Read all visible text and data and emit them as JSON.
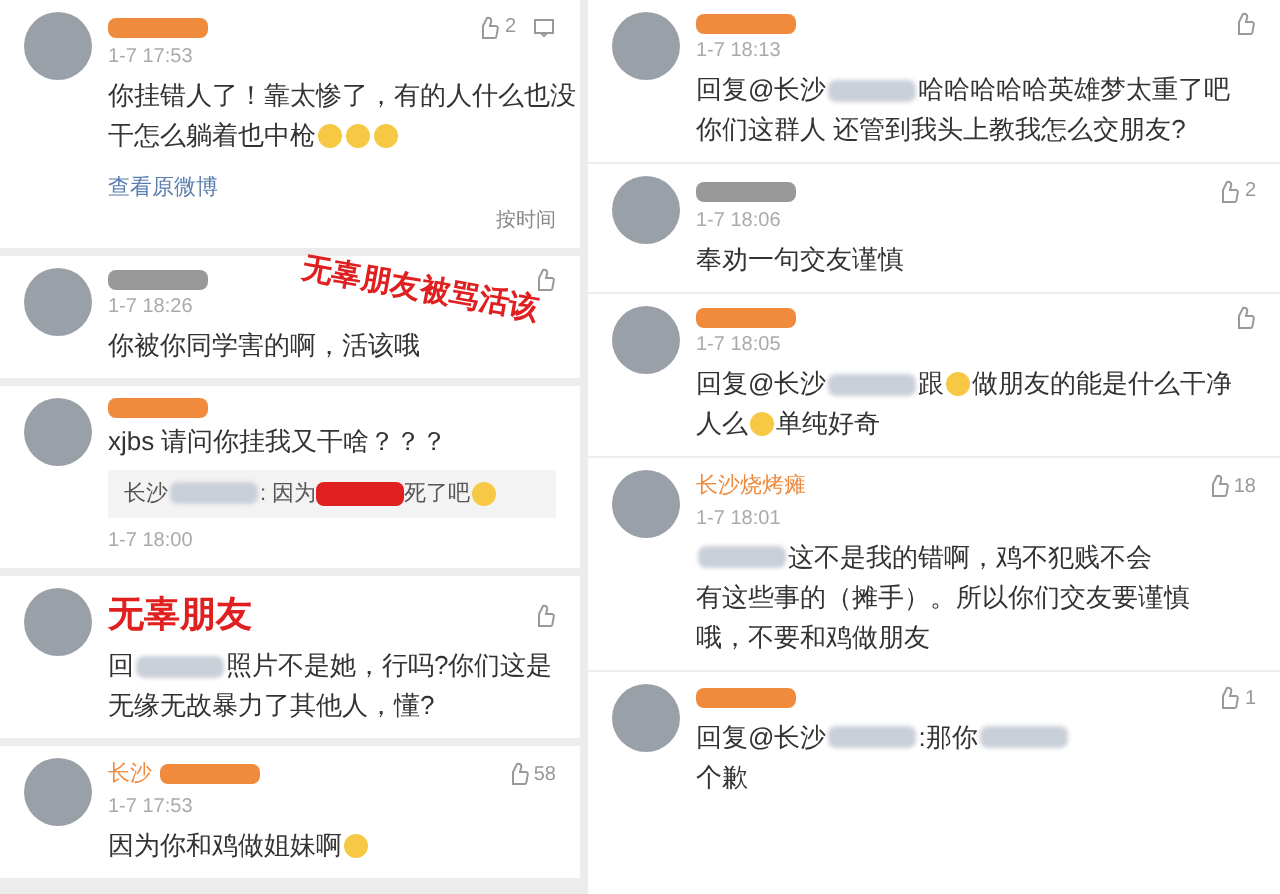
{
  "left": [
    {
      "color": "#f08a3c",
      "time": "1-7 17:53",
      "likes": "2",
      "comment_icon": true,
      "lines": [
        [
          {
            "kind": "text",
            "text": "你挂错人了！靠太惨了，有的人什么也没"
          }
        ],
        [
          {
            "kind": "text",
            "text": "干怎么躺着也中枪"
          },
          {
            "kind": "emoji"
          },
          {
            "kind": "emoji"
          },
          {
            "kind": "emoji"
          }
        ]
      ],
      "link": "查看原微博",
      "sort": "按时间"
    },
    {
      "color": "#999999",
      "time": "1-7 18:26",
      "lines": [
        [
          {
            "kind": "text",
            "text": "你被你同学害的啊，活该哦"
          }
        ]
      ],
      "annotation": "无辜朋友被骂活该"
    },
    {
      "color": "#f08a3c",
      "no_like": true,
      "lines": [
        [
          {
            "kind": "text",
            "text": "xjbs 请问你挂我又干啥？？？"
          }
        ]
      ],
      "reply": [
        {
          "kind": "text",
          "text": "长沙"
        },
        {
          "kind": "blur"
        },
        {
          "kind": "text",
          "text": ": 因为"
        },
        {
          "kind": "redact"
        },
        {
          "kind": "text",
          "text": "死了吧"
        },
        {
          "kind": "emoji"
        }
      ],
      "footer_time": "1-7 18:00"
    },
    {
      "annotation_title": "无辜朋友",
      "lines": [
        [
          {
            "kind": "text",
            "text": "回"
          },
          {
            "kind": "blur"
          },
          {
            "kind": "text",
            "text": "照片不是她，行吗?你们这是"
          }
        ],
        [
          {
            "kind": "text",
            "text": "无缘无故暴力了其他人，懂?"
          }
        ]
      ]
    },
    {
      "name": "长沙",
      "color": "#f08a3c",
      "time": "1-7 17:53",
      "likes": "58",
      "lines": [
        [
          {
            "kind": "text",
            "text": "因为你和鸡做姐妹啊"
          },
          {
            "kind": "emoji"
          }
        ]
      ]
    }
  ],
  "right": [
    {
      "color": "#f08a3c",
      "time": "1-7 18:13",
      "lines": [
        [
          {
            "kind": "text",
            "text": "回复@长沙"
          },
          {
            "kind": "blur"
          },
          {
            "kind": "text",
            "text": "哈哈哈哈哈英雄梦太重了吧"
          }
        ],
        [
          {
            "kind": "text",
            "text": "你们这群人 还管到我头上教我怎么交朋友?"
          }
        ]
      ]
    },
    {
      "color": "#999999",
      "time": "1-7 18:06",
      "likes": "2",
      "lines": [
        [
          {
            "kind": "text",
            "text": "奉劝一句交友谨慎"
          }
        ]
      ]
    },
    {
      "color": "#f08a3c",
      "time": "1-7 18:05",
      "lines": [
        [
          {
            "kind": "text",
            "text": "回复@长沙"
          },
          {
            "kind": "blur"
          },
          {
            "kind": "text",
            "text": "跟"
          },
          {
            "kind": "emoji"
          },
          {
            "kind": "text",
            "text": "做朋友的能是什么干净"
          }
        ],
        [
          {
            "kind": "text",
            "text": "人么"
          },
          {
            "kind": "emoji"
          },
          {
            "kind": "text",
            "text": "单纯好奇"
          }
        ]
      ]
    },
    {
      "name": "长沙烧烤瘫",
      "time": "1-7 18:01",
      "likes": "18",
      "lines": [
        [
          {
            "kind": "blur"
          },
          {
            "kind": "text",
            "text": "这不是我的错啊，鸡不犯贱不会"
          }
        ],
        [
          {
            "kind": "text",
            "text": "有这些事的（摊手）。所以你们交友要谨慎"
          }
        ],
        [
          {
            "kind": "text",
            "text": "哦，不要和鸡做朋友"
          }
        ]
      ]
    },
    {
      "color": "#f08a3c",
      "likes": "1",
      "lines": [
        [
          {
            "kind": "text",
            "text": "回复@长沙"
          },
          {
            "kind": "blur"
          },
          {
            "kind": "text",
            "text": ":那你"
          },
          {
            "kind": "blur"
          }
        ],
        [
          {
            "kind": "text",
            "text": "个歉"
          }
        ]
      ]
    }
  ]
}
